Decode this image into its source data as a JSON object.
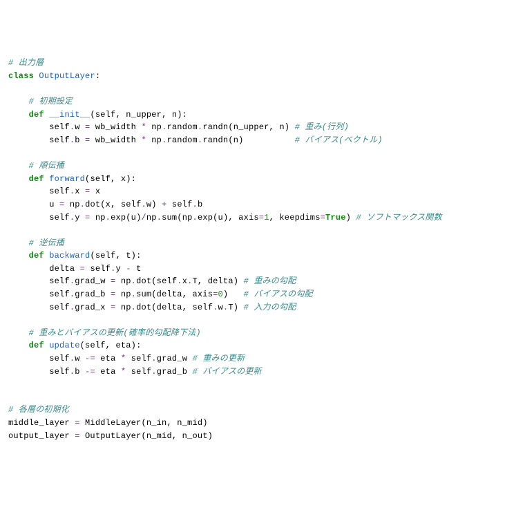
{
  "code": {
    "l1_c1": "# 出力層",
    "l2_kw1": "class",
    "l2_name": "OutputLayer",
    "l2_colon": ":",
    "l4_c": "# 初期設定",
    "l5_kw": "def",
    "l5_name": "__init__",
    "l5_args": "(self, n_upper, n):",
    "l6_a": "self",
    "l6_b": ".",
    "l6_c": "w ",
    "l6_eq": "=",
    "l6_d": " wb_width ",
    "l6_mul": "*",
    "l6_e": " np",
    "l6_f": ".",
    "l6_g": "random",
    "l6_h": ".",
    "l6_i": "randn(n_upper, n) ",
    "l6_cm": "# 重み(行列)",
    "l7_a": "self",
    "l7_b": ".",
    "l7_c": "b ",
    "l7_eq": "=",
    "l7_d": " wb_width ",
    "l7_mul": "*",
    "l7_e": " np",
    "l7_f": ".",
    "l7_g": "random",
    "l7_h": ".",
    "l7_i": "randn(n)          ",
    "l7_cm": "# バイアス(ベクトル)",
    "l9_c": "# 順伝播",
    "l10_kw": "def",
    "l10_name": "forward",
    "l10_args": "(self, x):",
    "l11_a": "self",
    "l11_b": ".",
    "l11_c": "x ",
    "l11_eq": "=",
    "l11_d": " x",
    "l12_a": "u ",
    "l12_eq": "=",
    "l12_b": " np",
    "l12_c": ".",
    "l12_d": "dot(x, self",
    "l12_e": ".",
    "l12_f": "w) ",
    "l12_plus": "+",
    "l12_g": " self",
    "l12_h": ".",
    "l12_i": "b",
    "l13_a": "self",
    "l13_b": ".",
    "l13_c": "y ",
    "l13_eq": "=",
    "l13_d": " np",
    "l13_e": ".",
    "l13_f": "exp(u)",
    "l13_div": "/",
    "l13_g": "np",
    "l13_h": ".",
    "l13_i": "sum(np",
    "l13_j": ".",
    "l13_k": "exp(u), axis",
    "l13_eq2": "=",
    "l13_num": "1",
    "l13_l": ", keepdims",
    "l13_eq3": "=",
    "l13_true": "True",
    "l13_m": ") ",
    "l13_cm": "# ソフトマックス関数",
    "l15_c": "# 逆伝播",
    "l16_kw": "def",
    "l16_name": "backward",
    "l16_args": "(self, t):",
    "l17_a": "delta ",
    "l17_eq": "=",
    "l17_b": " self",
    "l17_c": ".",
    "l17_d": "y ",
    "l17_minus": "-",
    "l17_e": " t",
    "l18_a": "self",
    "l18_b": ".",
    "l18_c": "grad_w ",
    "l18_eq": "=",
    "l18_d": " np",
    "l18_e": ".",
    "l18_f": "dot(self",
    "l18_g": ".",
    "l18_h": "x",
    "l18_i": ".",
    "l18_j": "T, delta) ",
    "l18_cm": "# 重みの勾配",
    "l19_a": "self",
    "l19_b": ".",
    "l19_c": "grad_b ",
    "l19_eq": "=",
    "l19_d": " np",
    "l19_e": ".",
    "l19_f": "sum(delta, axis",
    "l19_eq2": "=",
    "l19_num": "0",
    "l19_g": ")   ",
    "l19_cm": "# バイアスの勾配",
    "l20_a": "self",
    "l20_b": ".",
    "l20_c": "grad_x ",
    "l20_eq": "=",
    "l20_d": " np",
    "l20_e": ".",
    "l20_f": "dot(delta, self",
    "l20_g": ".",
    "l20_h": "w",
    "l20_i": ".",
    "l20_j": "T) ",
    "l20_cm": "# 入力の勾配",
    "l22_c": "# 重みとバイアスの更新(確率的勾配降下法)",
    "l23_kw": "def",
    "l23_name": "update",
    "l23_args": "(self, eta):",
    "l24_a": "self",
    "l24_b": ".",
    "l24_c": "w ",
    "l24_op": "-=",
    "l24_d": " eta ",
    "l24_mul": "*",
    "l24_e": " self",
    "l24_f": ".",
    "l24_g": "grad_w ",
    "l24_cm": "# 重みの更新",
    "l25_a": "self",
    "l25_b": ".",
    "l25_c": "b ",
    "l25_op": "-=",
    "l25_d": " eta ",
    "l25_mul": "*",
    "l25_e": " self",
    "l25_f": ".",
    "l25_g": "grad_b ",
    "l25_cm": "# バイアスの更新",
    "l28_c": "# 各層の初期化",
    "l29_a": "middle_layer ",
    "l29_eq": "=",
    "l29_b": " MiddleLayer(n_in, n_mid)",
    "l30_a": "output_layer ",
    "l30_eq": "=",
    "l30_b": " OutputLayer(n_mid, n_out)"
  }
}
